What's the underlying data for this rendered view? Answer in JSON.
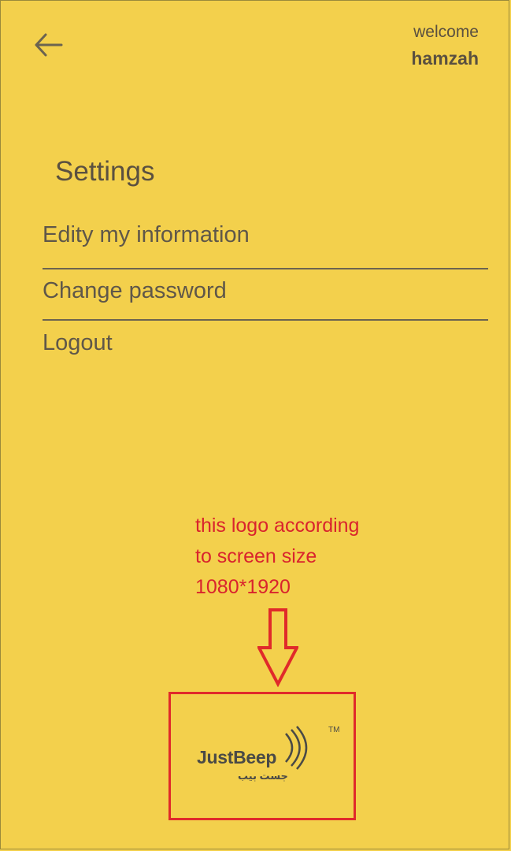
{
  "header": {
    "welcome_label": "welcome",
    "username": "hamzah"
  },
  "settings": {
    "title": "Settings",
    "items": [
      {
        "label": "Edity my information"
      },
      {
        "label": "Change password"
      },
      {
        "label": "Logout"
      }
    ]
  },
  "annotation": {
    "lines": [
      "this logo according",
      "to screen size",
      "1080*1920"
    ]
  },
  "logo": {
    "name": "JustBeep",
    "arabic": "جست بيب",
    "tm": "TM"
  },
  "colors": {
    "background": "#f3d04c",
    "text": "#5a5040",
    "annotation": "#d9232d"
  },
  "icons": {
    "back": "arrow-left-icon",
    "annotation_arrow": "arrow-down-outline-icon"
  }
}
